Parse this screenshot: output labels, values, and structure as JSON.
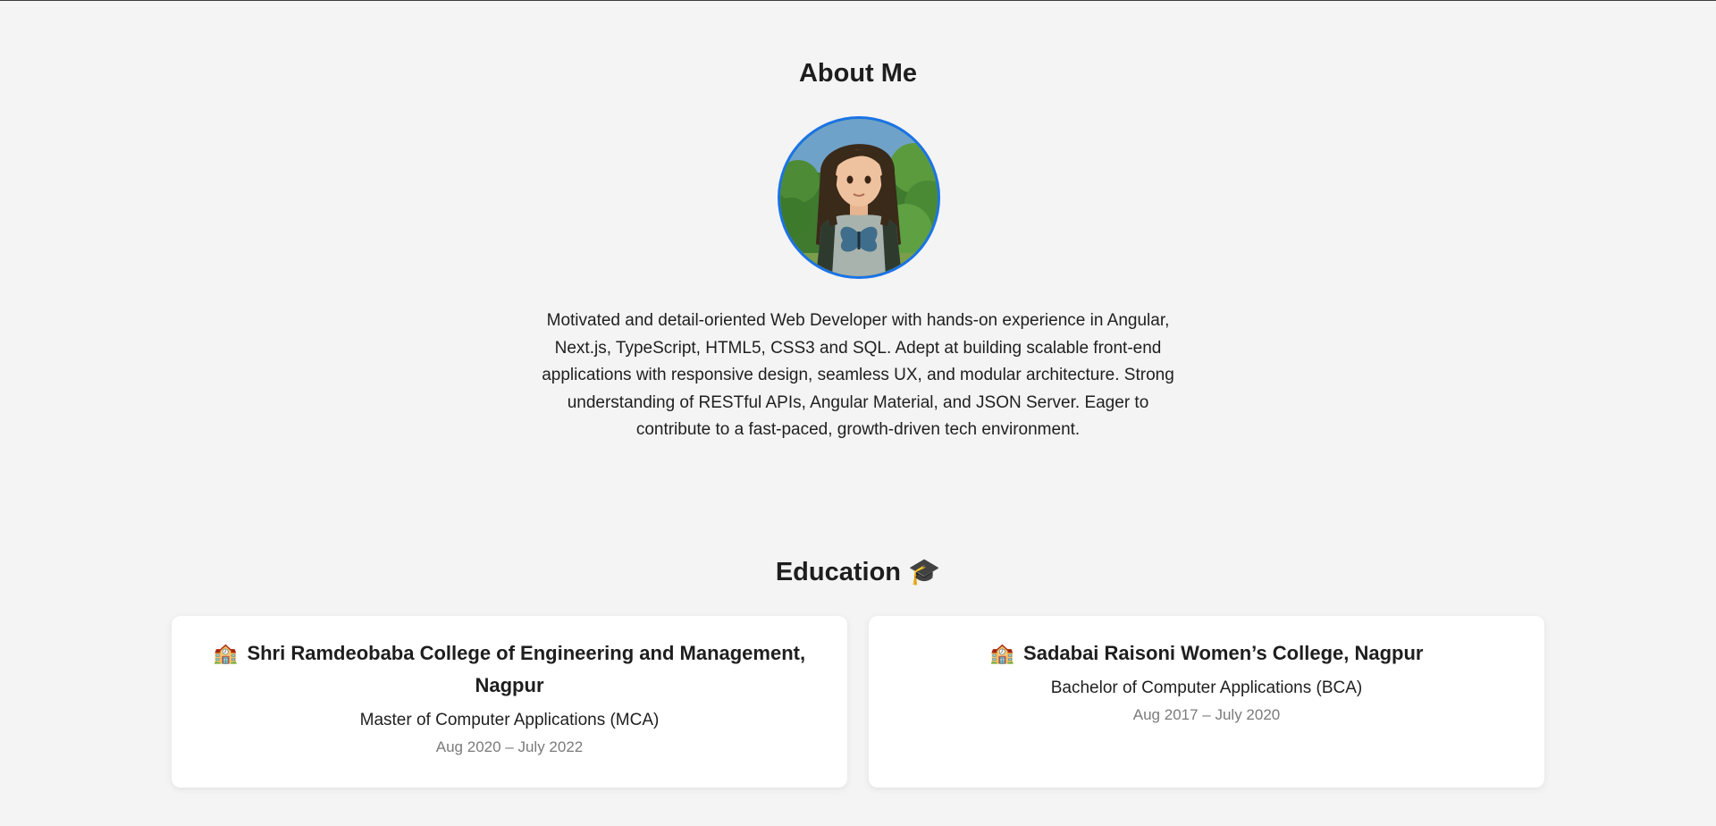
{
  "about": {
    "title": "About Me",
    "bio": "Motivated and detail-oriented Web Developer with hands-on experience in Angular, Next.js, TypeScript, HTML5, CSS3 and SQL. Adept at building scalable front-end applications with responsive design, seamless UX, and modular architecture. Strong understanding of RESTful APIs, Angular Material, and JSON Server. Eager to contribute to a fast-paced, growth-driven tech environment."
  },
  "education": {
    "title": "Education",
    "title_emoji": "🎓",
    "items": [
      {
        "emoji": "🏫",
        "institution": "Shri Ramdeobaba College of Engineering and Management, Nagpur",
        "degree": "Master of Computer Applications (MCA)",
        "dates": "Aug 2020 – July 2022"
      },
      {
        "emoji": "🏫",
        "institution": "Sadabai Raisoni Women’s College, Nagpur",
        "degree": "Bachelor of Computer Applications (BCA)",
        "dates": "Aug 2017 – July 2020"
      }
    ]
  },
  "colors": {
    "background": "#f4f4f4",
    "avatar_border": "#1a73e8",
    "card_background": "#ffffff",
    "muted_text": "#7b7b7b"
  }
}
